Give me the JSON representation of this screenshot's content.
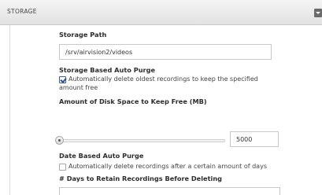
{
  "panel": {
    "title": "STORAGE"
  },
  "storage_path": {
    "label": "Storage Path",
    "value": "/srv/airvision2/videos"
  },
  "storage_purge": {
    "label": "Storage Based Auto Purge",
    "checked": true,
    "text_line1": "Automatically delete oldest recordings to keep the specified",
    "text_line2": "amount free"
  },
  "disk_space": {
    "label": "Amount of Disk Space to Keep Free (MB)",
    "value": "5000",
    "slider_fraction": 0.0
  },
  "date_purge": {
    "label": "Date Based Auto Purge",
    "checked": false,
    "text": "Automatically delete recordings after a certain amount of days"
  },
  "days_retain": {
    "label": "# Days to Retain Recordings Before Deleting",
    "value": ""
  }
}
